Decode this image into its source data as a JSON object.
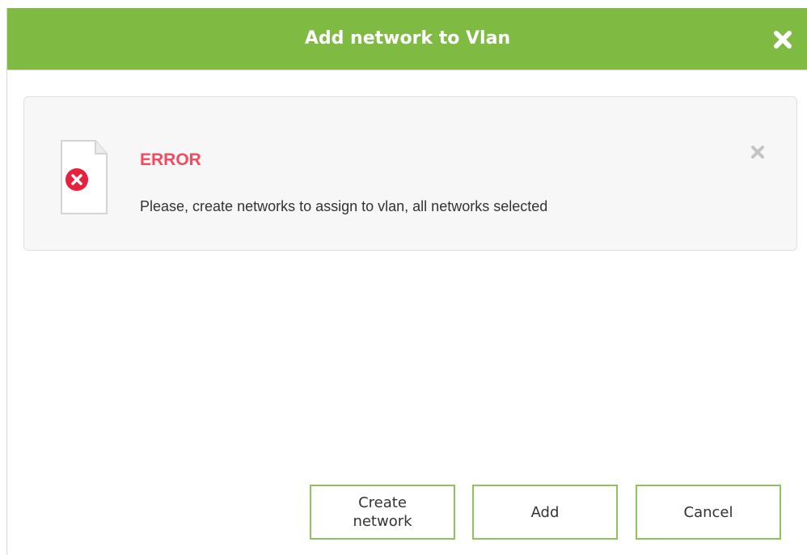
{
  "dialog": {
    "title": "Add network to Vlan",
    "close_icon": "close-icon"
  },
  "message": {
    "title": "ERROR",
    "text": "Please, create networks to assign to vlan, all networks selected",
    "icon": "error-document-icon",
    "dismiss_icon": "close-icon"
  },
  "buttons": {
    "create_network": "Create network",
    "add": "Add",
    "cancel": "Cancel"
  },
  "colors": {
    "header": "#7fba42",
    "error": "#f44a5e",
    "button_border": "#8cc45a"
  }
}
